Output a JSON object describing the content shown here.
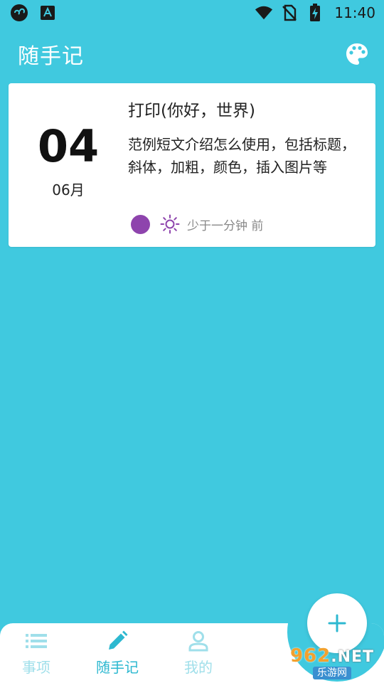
{
  "status_bar": {
    "time": "11:40",
    "left_icons": [
      "cloud-sync-icon",
      "font-a-icon"
    ],
    "right_icons": [
      "wifi-icon",
      "no-sim-icon",
      "battery-charging-icon"
    ]
  },
  "app_bar": {
    "title": "随手记",
    "action_icon": "palette-icon"
  },
  "note": {
    "day": "04",
    "month": "06月",
    "title": "打印(你好，世界)",
    "body": "范例短文介绍怎么使用，包括标题，斜体，加粗，颜色，插入图片等",
    "color": "#8E44AD",
    "weather_icon": "sun-icon",
    "time_ago": "少于一分钟 前"
  },
  "bottom_nav": {
    "items": [
      {
        "label": "事项",
        "icon": "list-icon",
        "active": false
      },
      {
        "label": "随手记",
        "icon": "pencil-icon",
        "active": true
      },
      {
        "label": "我的",
        "icon": "user-icon",
        "active": false
      }
    ]
  },
  "fab": {
    "icon": "plus-icon"
  },
  "watermark": {
    "main": "962",
    "suffix": ".NET",
    "sub": "乐游网"
  },
  "colors": {
    "background": "#40C9DF",
    "card": "#FFFFFF",
    "accent": "#2DB8D0",
    "inactive_nav": "#9FDFEA",
    "note_dot": "#8E44AD"
  }
}
